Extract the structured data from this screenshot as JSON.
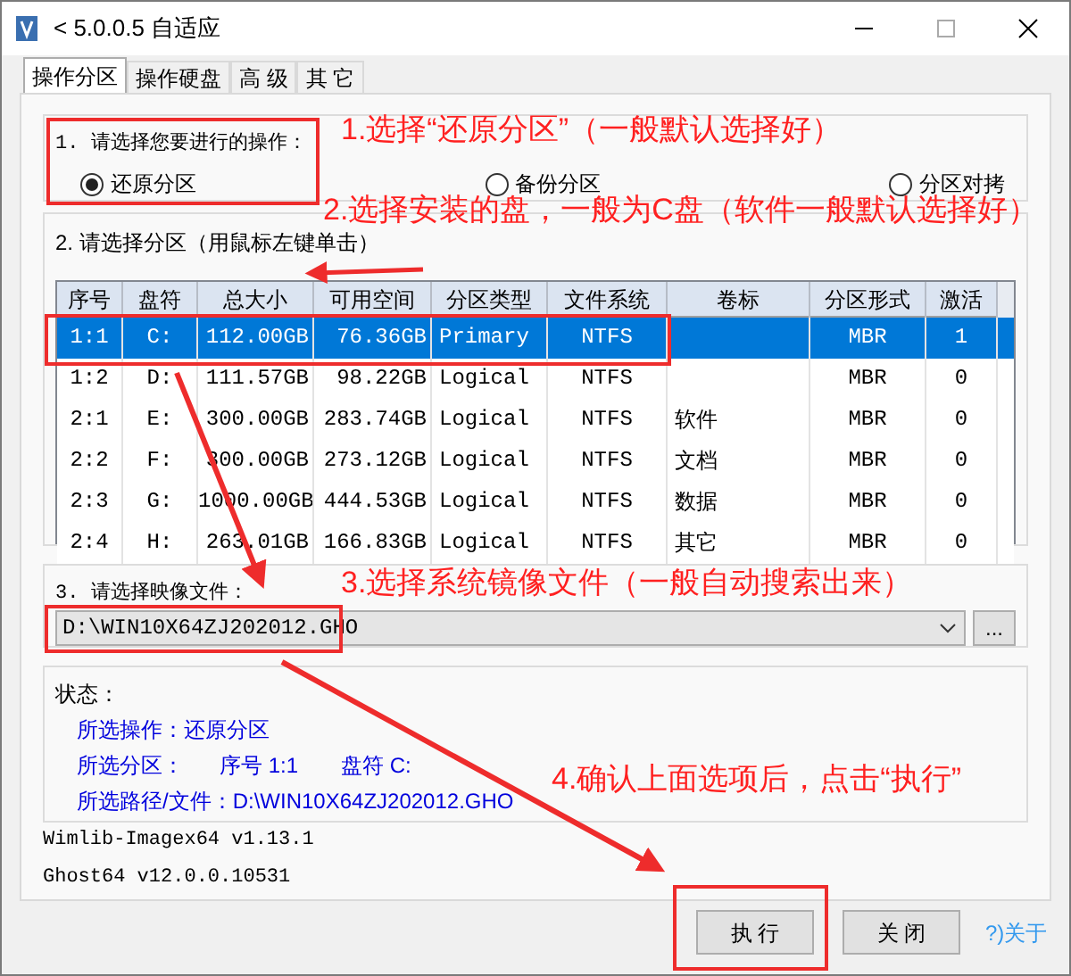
{
  "window": {
    "title": "< 5.0.0.5 自适应"
  },
  "tabs": [
    {
      "label": "操作分区",
      "selected": true
    },
    {
      "label": "操作硬盘",
      "selected": false
    },
    {
      "label": "高 级",
      "selected": false
    },
    {
      "label": "其 它",
      "selected": false
    }
  ],
  "operation": {
    "label": "1. 请选择您要进行的操作：",
    "options": [
      {
        "label": "还原分区",
        "selected": true
      },
      {
        "label": "备份分区",
        "selected": false
      },
      {
        "label": "分区对拷",
        "selected": false
      }
    ]
  },
  "partitions": {
    "label": "2. 请选择分区（用鼠标左键单击）",
    "columns": [
      "序号",
      "盘符",
      "总大小",
      "可用空间",
      "分区类型",
      "文件系统",
      "卷标",
      "分区形式",
      "激活"
    ],
    "rows": [
      {
        "cells": [
          "1:1",
          "C:",
          "112.00GB",
          "76.36GB",
          "Primary",
          "NTFS",
          "",
          "MBR",
          "1"
        ],
        "selected": true
      },
      {
        "cells": [
          "1:2",
          "D:",
          "111.57GB",
          "98.22GB",
          "Logical",
          "NTFS",
          "",
          "MBR",
          "0"
        ],
        "selected": false
      },
      {
        "cells": [
          "2:1",
          "E:",
          "300.00GB",
          "283.74GB",
          "Logical",
          "NTFS",
          "软件",
          "MBR",
          "0"
        ],
        "selected": false
      },
      {
        "cells": [
          "2:2",
          "F:",
          "300.00GB",
          "273.12GB",
          "Logical",
          "NTFS",
          "文档",
          "MBR",
          "0"
        ],
        "selected": false
      },
      {
        "cells": [
          "2:3",
          "G:",
          "1000.00GB",
          "444.53GB",
          "Logical",
          "NTFS",
          "数据",
          "MBR",
          "0"
        ],
        "selected": false
      },
      {
        "cells": [
          "2:4",
          "H:",
          "263.01GB",
          "166.83GB",
          "Logical",
          "NTFS",
          "其它",
          "MBR",
          "0"
        ],
        "selected": false
      }
    ]
  },
  "image_file": {
    "label": "3. 请选择映像文件：",
    "value": "D:\\WIN10X64ZJ202012.GHO",
    "browse_button": "..."
  },
  "status": {
    "label": "状态：",
    "lines": [
      [
        "所选操作：还原分区"
      ],
      [
        "所选分区：",
        "序号 1:1",
        "盘符 C:"
      ],
      [
        "所选路径/文件：D:\\WIN10X64ZJ202012.GHO"
      ]
    ]
  },
  "versions": [
    "Wimlib-Imagex64 v1.13.1",
    "Ghost64 v12.0.0.10531"
  ],
  "buttons": [
    "执 行",
    "关 闭"
  ],
  "about_link": "?)关于",
  "annotations": [
    "1.选择“还原分区”（一般默认选择好）",
    "2.选择安装的盘，一般为C盘（软件一般默认选择好）",
    "3.选择系统镜像文件（一般自动搜索出来）",
    "4.确认上面选项后，点击“执行”"
  ]
}
